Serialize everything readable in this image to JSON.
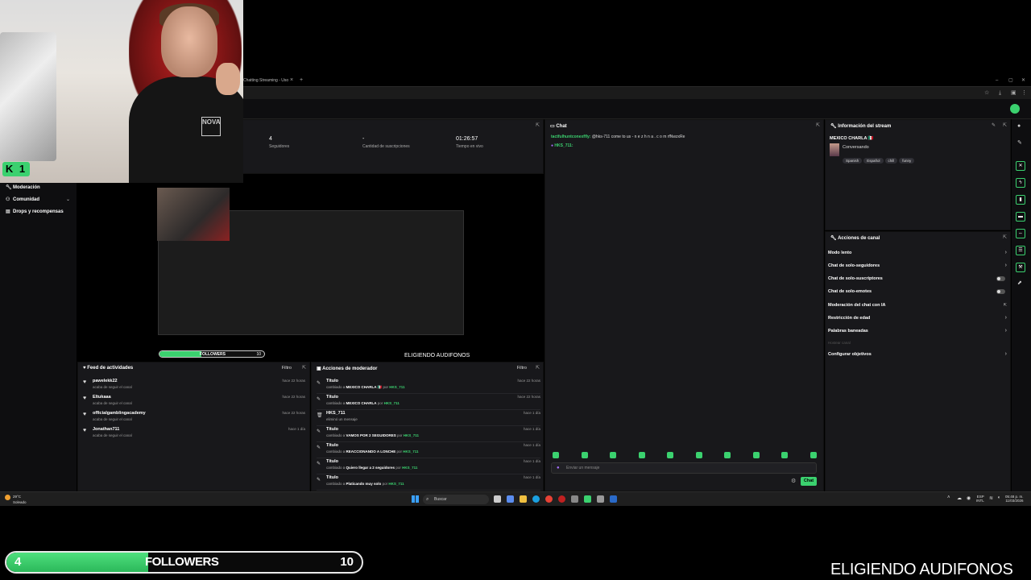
{
  "browser": {
    "tab_title": "Chatting Streaming - Uso",
    "tab_close": "×",
    "new_tab": "+"
  },
  "stats": [
    {
      "value": "4",
      "label": "Seguidores"
    },
    {
      "value": "-",
      "label": "Cantidad de suscripciones"
    },
    {
      "value": "01:26:57",
      "label": "Tiempo en vivo"
    }
  ],
  "nav": {
    "items": [
      {
        "label": "Moderación",
        "icon": "wrench-icon"
      },
      {
        "label": "Comunidad",
        "icon": "people-icon"
      },
      {
        "label": "Drops y recompensas",
        "icon": "gift-icon"
      }
    ]
  },
  "preview": {
    "followers_label": "FOLLOWERS",
    "followers_current": "4",
    "followers_goal": "10",
    "caption": "ELIGIENDO AUDIFONOS"
  },
  "activity_feed": {
    "title": "Feed de actividades",
    "filter": "Filtro",
    "items": [
      {
        "name": "pawelekk22",
        "sub": "acaba de seguir el canal",
        "time": "hace 22 horas"
      },
      {
        "name": "Eltukaaa",
        "sub": "acaba de seguir el canal",
        "time": "hace 22 horas"
      },
      {
        "name": "officialgamblingacademy",
        "sub": "acaba de seguir el canal",
        "time": "hace 22 horas"
      },
      {
        "name": "Jonathan711",
        "sub": "acaba de seguir el canal",
        "time": "hace 1 día"
      }
    ]
  },
  "mod_actions": {
    "title": "Acciones de moderador",
    "filter": "Filtro",
    "items": [
      {
        "title": "Título",
        "pre": "cambiado a",
        "obj": "MEXICO CHARLA 🇲🇽",
        "by_pre": "por",
        "by": "HKS_711",
        "time": "hace 22 horas"
      },
      {
        "title": "Título",
        "pre": "cambiado a",
        "obj": "MEXICO CHARLA",
        "by_pre": "por",
        "by": "HKS_711",
        "time": "hace 22 horas"
      },
      {
        "title": "HKS_711",
        "pre": "eliminó un mensaje",
        "obj": "",
        "by_pre": "",
        "by": "",
        "time": "hace 1 día"
      },
      {
        "title": "Título",
        "pre": "cambiado a",
        "obj": "VAMOS POR 2 SEGUIDORES",
        "by_pre": "por",
        "by": "HKS_711",
        "time": "hace 1 día"
      },
      {
        "title": "Título",
        "pre": "cambiado a",
        "obj": "REACCIONANDO A LONCHE",
        "by_pre": "por",
        "by": "HKS_711",
        "time": "hace 1 día"
      },
      {
        "title": "Título",
        "pre": "cambiado a",
        "obj": "Quiero llegar a 2 seguidores",
        "by_pre": "por",
        "by": "HKS_711",
        "time": "hace 1 día"
      },
      {
        "title": "Título",
        "pre": "cambiado a",
        "obj": "Platicando muy solo",
        "by_pre": "por",
        "by": "HKS_711",
        "time": "hace 1 día"
      }
    ]
  },
  "chat": {
    "title": "Chat",
    "msg_user": "tactfulhuntconexffly:",
    "msg_text": " @hks-711 come to us - n e z h n a . c o m rfNwzxRe",
    "msg2_user": "HKS_711:",
    "placeholder": "Enviar un mensaje",
    "send_label": "Chat"
  },
  "stream_info": {
    "title": "Información del stream",
    "stream_title": "MEXICO CHARLA 🇲🇽",
    "category": "Conversando",
    "tags": [
      "Spanish",
      "Español",
      "chill",
      "funny"
    ]
  },
  "channel_actions": {
    "title": "Acciones de canal",
    "items": [
      {
        "label": "Modo lento",
        "control": "chevron"
      },
      {
        "label": "Chat de solo-seguidores",
        "control": "chevron"
      },
      {
        "label": "Chat de solo-suscriptores",
        "control": "toggle"
      },
      {
        "label": "Chat de solo-emotes",
        "control": "toggle"
      },
      {
        "label": "Moderación del chat con IA",
        "control": "external"
      },
      {
        "label": "Restricción de edad",
        "control": "chevron"
      },
      {
        "label": "Palabras baneadas",
        "control": "chevron"
      },
      {
        "label": "Hostear canal",
        "control": "none"
      },
      {
        "label": "Configurar objetivos",
        "control": "chevron"
      }
    ]
  },
  "taskbar": {
    "temp": "29°C",
    "weather": "Soleado",
    "search": "Buscar",
    "lang": "ESP",
    "lang2": "INTL",
    "time": "05:48 p. m.",
    "date": "11/03/2026"
  },
  "webcam": {
    "badge": "K 1",
    "shirt_logo": "NOVA"
  },
  "overlay": {
    "followers_current": "4",
    "followers_label": "FOLLOWERS",
    "followers_goal": "10",
    "followers_progress": 0.4,
    "caption": "ELIGIENDO AUDIFONOS"
  },
  "colors": {
    "accent": "#3bd16f",
    "panel": "#18181b",
    "background": "#000000"
  }
}
